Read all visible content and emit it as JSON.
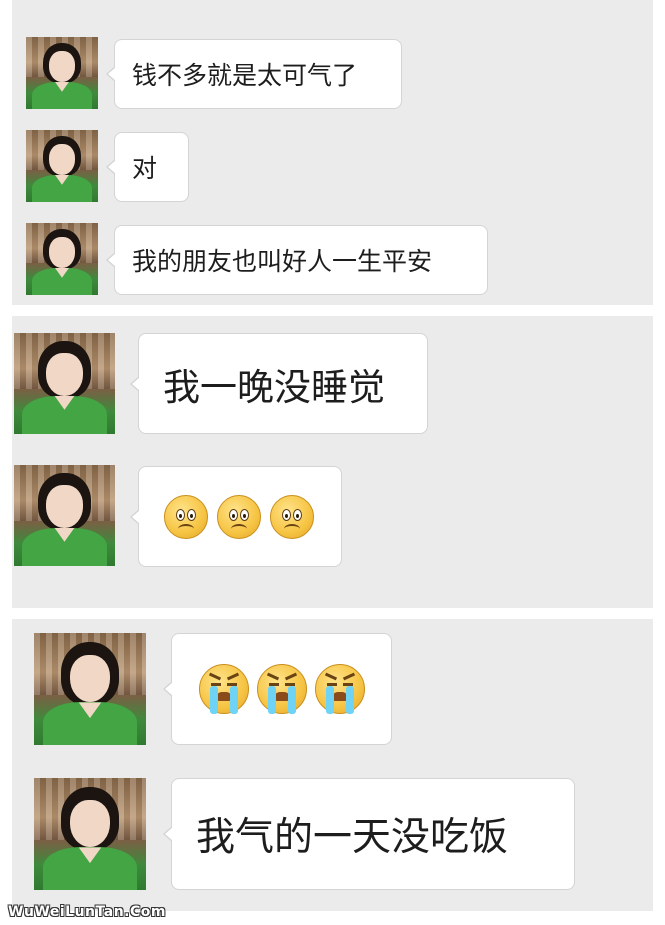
{
  "top_partial": {
    "bubble_color": "#a3e26a",
    "avatar_color": "#37b34a"
  },
  "panels": [
    {
      "messages": [
        {
          "sender": "contact",
          "text": "钱不多就是太可气了"
        },
        {
          "sender": "contact",
          "text": "对"
        },
        {
          "sender": "contact",
          "text": "我的朋友也叫好人一生平安"
        }
      ]
    },
    {
      "messages": [
        {
          "sender": "contact",
          "text": "我一晚没睡觉"
        },
        {
          "sender": "contact",
          "emojis": [
            "sad-face-icon",
            "sad-face-icon",
            "sad-face-icon"
          ]
        }
      ]
    },
    {
      "messages": [
        {
          "sender": "contact",
          "emojis": [
            "crying-face-icon",
            "crying-face-icon",
            "crying-face-icon"
          ]
        },
        {
          "sender": "contact",
          "text": "我气的一天没吃饭"
        }
      ]
    }
  ],
  "watermark": "WuWeiLunTan.Com",
  "colors": {
    "panel_bg": "#ebebeb",
    "bubble_bg": "#ffffff",
    "bubble_border": "#d4d4d4",
    "jacket_green": "#43a544"
  }
}
